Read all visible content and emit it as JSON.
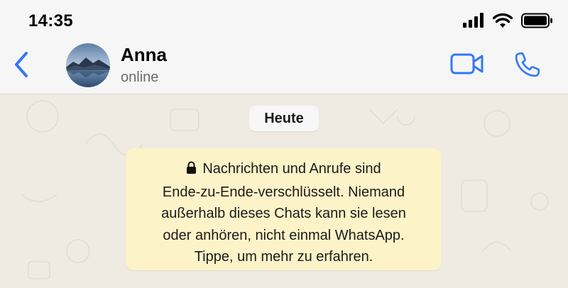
{
  "status_bar": {
    "time": "14:35",
    "icons": [
      "signal-icon",
      "wifi-icon",
      "battery-icon"
    ]
  },
  "nav_bar": {
    "back_icon": "chevron-left-icon",
    "contact_name": "Anna",
    "contact_status": "online",
    "actions": [
      "video-call-icon",
      "phone-icon"
    ]
  },
  "chat": {
    "date_label": "Heute",
    "encryption_notice": {
      "icon": "lock-icon",
      "lines": [
        "Nachrichten und Anrufe sind",
        "Ende-zu-Ende-verschlüsselt. Niemand",
        "außerhalb dieses Chats kann sie lesen",
        "oder anhören, nicht einmal WhatsApp.",
        "Tippe, um mehr zu erfahren."
      ]
    }
  },
  "colors": {
    "accent": "#3478f6",
    "header_bg": "#f6f6f6",
    "chat_bg": "#efeae2",
    "notice_bg": "#fdf3c8"
  }
}
